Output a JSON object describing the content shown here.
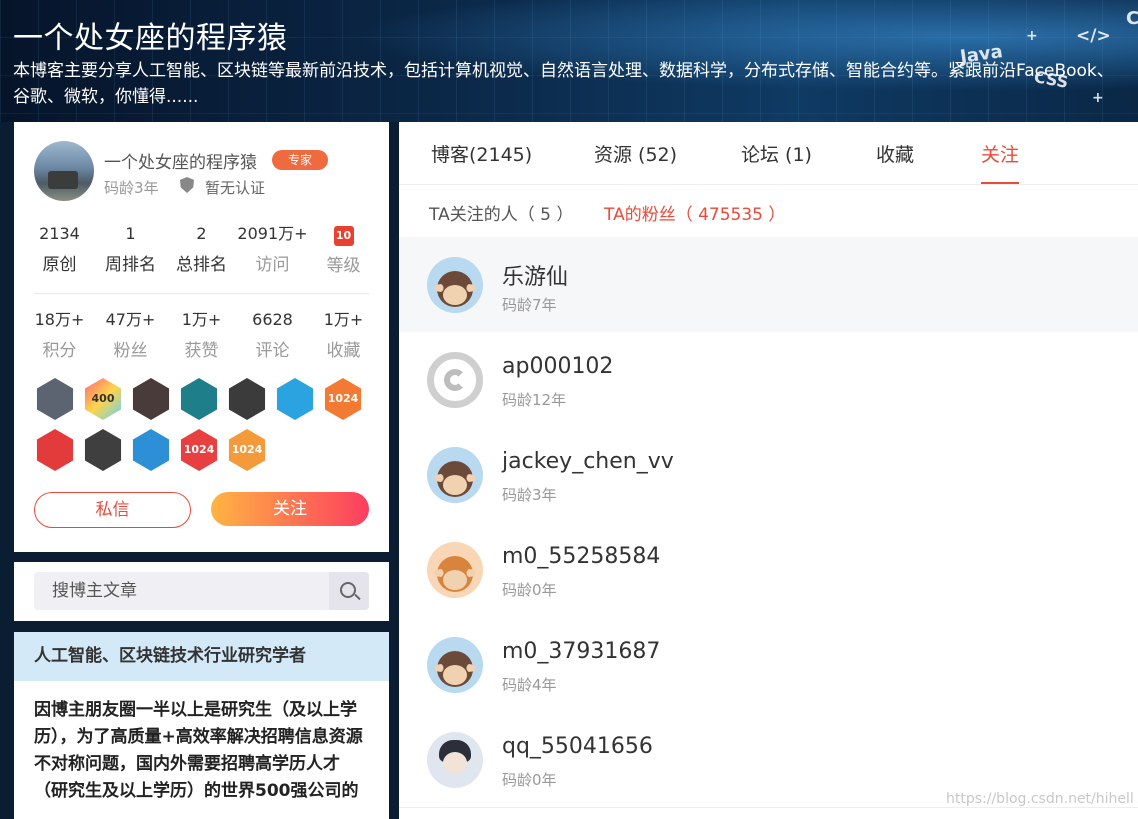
{
  "header": {
    "title": "一个处女座的程序猿",
    "description": "本博客主要分享人工智能、区块链等最新前沿技术，包括计算机视觉、自然语言处理、数据科学，分布式存储、智能合约等。紧跟前沿FaceBook、谷歌、微软，你懂得......",
    "deco": {
      "java": "Java",
      "css": "CSS",
      "code": "</>",
      "plus": "+",
      "c": "C"
    }
  },
  "profile": {
    "name": "一个处女座的程序猿",
    "badge": "专家",
    "age": "码龄3年",
    "cert": "暂无认证",
    "stats_row1": [
      {
        "num": "2134",
        "label": "原创"
      },
      {
        "num": "1",
        "label": "周排名"
      },
      {
        "num": "2",
        "label": "总排名"
      },
      {
        "num": "2091万+",
        "label": "访问"
      },
      {
        "num": "10",
        "label": "等级"
      }
    ],
    "stats_row2": [
      {
        "num": "18万+",
        "label": "积分"
      },
      {
        "num": "47万+",
        "label": "粉丝"
      },
      {
        "num": "1万+",
        "label": "获赞"
      },
      {
        "num": "6628",
        "label": "评论"
      },
      {
        "num": "1万+",
        "label": "收藏"
      }
    ],
    "badges": [
      "github-badge",
      "400-badge",
      "2020-badge",
      "list-badge",
      "grade-badge",
      "star-badge",
      "1024-badge",
      "pen-badge",
      "medal-badge",
      "star2-badge",
      "1024-red-badge",
      "1024-orange-badge"
    ],
    "badge_text": {
      "b400": "400",
      "b1024": "1024"
    },
    "message_button": "私信",
    "follow_button": "关注",
    "colors": {
      "accent": "#e94a3a",
      "follow_start": "#ffb443",
      "follow_end": "#fc3d5f"
    }
  },
  "search": {
    "placeholder": "搜博主文章"
  },
  "about": {
    "title": "人工智能、区块链技术行业研究学者",
    "body": "因博主朋友圈一半以上是研究生（及以上学历），为了高质量+高效率解决招聘信息资源不对称问题，国内外需要招聘高学历人才（研究生及以上学历）的世界500强公司的"
  },
  "tabs": [
    {
      "label": "博客(2145)"
    },
    {
      "label": "资源 (52)"
    },
    {
      "label": "论坛 (1)"
    },
    {
      "label": "收藏"
    },
    {
      "label": "关注"
    }
  ],
  "subtabs": {
    "following": "TA关注的人（ 5 ）",
    "fans": "TA的粉丝（ 475535 ）"
  },
  "fans": [
    {
      "name": "乐游仙",
      "age": "码龄7年"
    },
    {
      "name": "ap000102",
      "age": "码龄12年"
    },
    {
      "name": "jackey_chen_vv",
      "age": "码龄3年"
    },
    {
      "name": "m0_55258584",
      "age": "码龄0年"
    },
    {
      "name": "m0_37931687",
      "age": "码龄4年"
    },
    {
      "name": "qq_55041656",
      "age": "码龄0年"
    }
  ],
  "watermark": "https://blog.csdn.net/hihell"
}
